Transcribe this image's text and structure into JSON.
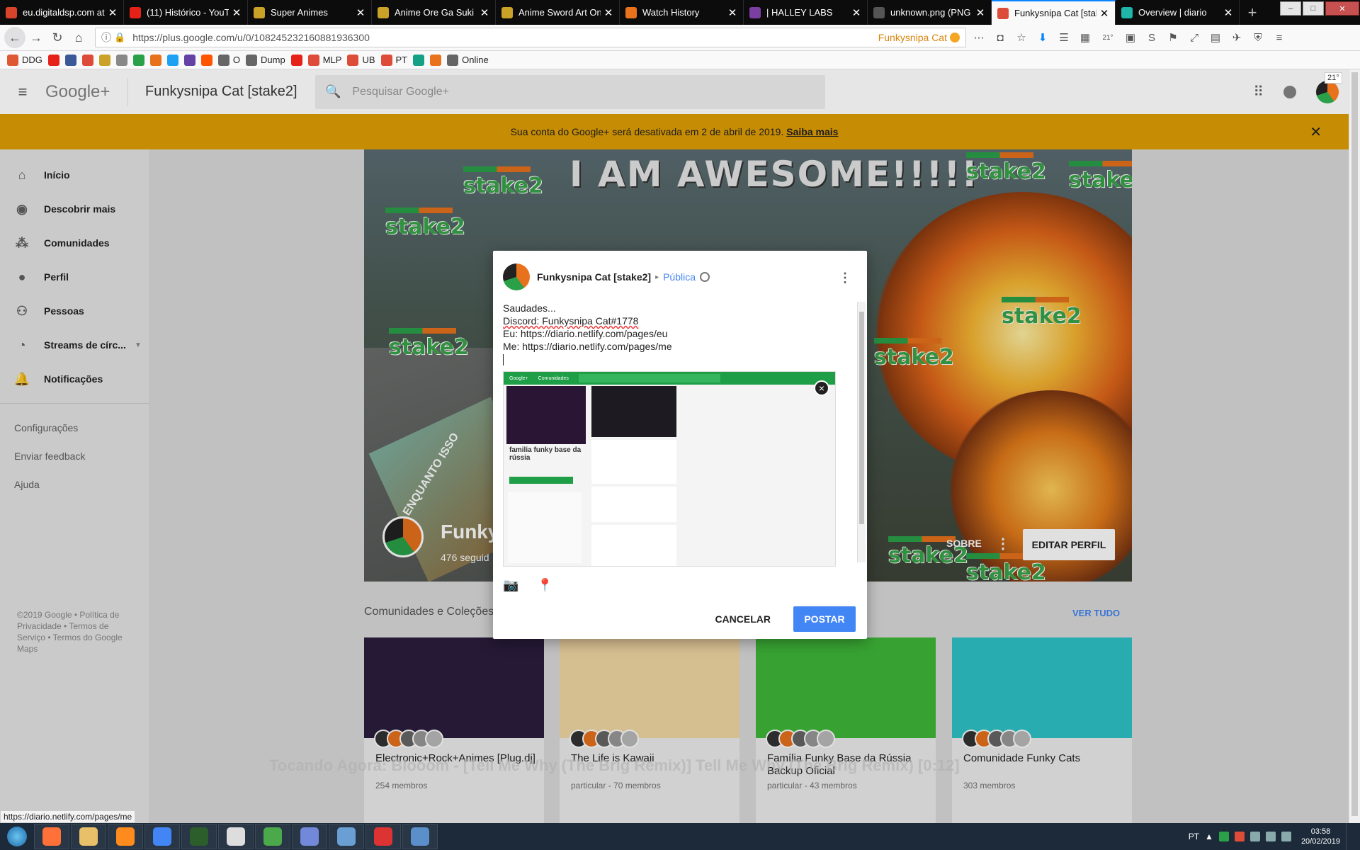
{
  "browser": {
    "tabs": [
      {
        "title": "eu.digitaldsp.com at l",
        "color": "#d8432b",
        "active": false
      },
      {
        "title": "(11) Histórico - YouTu",
        "color": "#e62117",
        "active": false
      },
      {
        "title": "Super Animes",
        "color": "#c9a227",
        "active": false
      },
      {
        "title": "Anime Ore Ga Suki N",
        "color": "#c9a227",
        "active": false
      },
      {
        "title": "Anime Sword Art Onl",
        "color": "#c9a227",
        "active": false
      },
      {
        "title": "Watch History",
        "color": "#e8731c",
        "active": false
      },
      {
        "title": "| HALLEY LABS",
        "color": "#7a3fa0",
        "active": false
      },
      {
        "title": "unknown.png (PNG Imag",
        "color": "#555555",
        "active": false
      },
      {
        "title": "Funkysnipa Cat [stak",
        "color": "#dd4b39",
        "active": true
      },
      {
        "title": "Overview | diario",
        "color": "#1fb5a8",
        "active": false
      }
    ],
    "url": "https://plus.google.com/u/0/108245232160881936300",
    "url_account": "Funkysnipa Cat",
    "badge_count": "21°",
    "bookmarks": [
      {
        "label": "DDG",
        "color": "#de5833"
      },
      {
        "label": "",
        "color": "#e62117"
      },
      {
        "label": "",
        "color": "#3b5998"
      },
      {
        "label": "",
        "color": "#dd4b39"
      },
      {
        "label": "",
        "color": "#c9a227"
      },
      {
        "label": "",
        "color": "#888888"
      },
      {
        "label": "",
        "color": "#2aa149"
      },
      {
        "label": "",
        "color": "#e8711c"
      },
      {
        "label": "",
        "color": "#1da1f2"
      },
      {
        "label": "",
        "color": "#6441a5"
      },
      {
        "label": "",
        "color": "#ff5500"
      },
      {
        "label": "O",
        "color": "#666666"
      },
      {
        "label": "Dump",
        "color": "#666666"
      },
      {
        "label": "",
        "color": "#e62117"
      },
      {
        "label": "MLP",
        "color": "#dd4b39"
      },
      {
        "label": "UB",
        "color": "#dd4b39"
      },
      {
        "label": "PT",
        "color": "#dd4b39"
      },
      {
        "label": "",
        "color": "#16a085"
      },
      {
        "label": "",
        "color": "#e8731c"
      },
      {
        "label": "Online",
        "color": "#666666"
      }
    ]
  },
  "google_plus": {
    "logo": "Google+",
    "profile_title": "Funkysnipa Cat [stake2]",
    "search_placeholder": "Pesquisar Google+",
    "banner_text": "Sua conta do Google+ será desativada em 2 de abril de 2019.",
    "banner_link": "Saiba mais",
    "nav": [
      {
        "label": "Início",
        "icon": "home-icon",
        "glyph": "⌂"
      },
      {
        "label": "Descobrir mais",
        "icon": "compass-icon",
        "glyph": "◉"
      },
      {
        "label": "Comunidades",
        "icon": "communities-icon",
        "glyph": "⁂"
      },
      {
        "label": "Perfil",
        "icon": "profile-icon",
        "glyph": "●"
      },
      {
        "label": "Pessoas",
        "icon": "people-icon",
        "glyph": "⚇"
      },
      {
        "label": "Streams de círc...",
        "icon": "streams-icon",
        "glyph": "◔"
      },
      {
        "label": "Notificações",
        "icon": "bell-icon",
        "glyph": "🔔"
      }
    ],
    "secondary": [
      "Configurações",
      "Enviar feedback",
      "Ajuda"
    ],
    "footer": "©2019 Google • Política de Privacidade • Termos de Serviço • Termos do Google Maps",
    "cover": {
      "headline": "I AM AWESOME!!!!!",
      "sticker": "stake2",
      "sign_text": "ENQUANTO ISSO",
      "name": "Funky",
      "followers": "476 seguid",
      "sobre": "SOBRE",
      "edit_button": "EDITAR PERFIL"
    },
    "section_title": "Comunidades e Coleções",
    "see_all": "VER TUDO",
    "communities": [
      {
        "name": "Electronic+Rock+Animes [Plug.dj]",
        "meta": "254 membros",
        "color": "#2b1d3d"
      },
      {
        "name": "The Life is Kawaii",
        "meta": "particular - 70 membros",
        "color": "#f3d9a4"
      },
      {
        "name": "Família Funky Base da Rússia Backup Oficial",
        "meta": "particular - 43 membros",
        "color": "#3fb93a"
      },
      {
        "name": "Comunidade Funky Cats",
        "meta": "303 membros",
        "color": "#2ec4c8"
      }
    ],
    "now_playing": "Tocando Agora: Blooom - [Tell Me Why (The Brig Remix)] Tell Me Why (The Brig Remix) [0:12]"
  },
  "dialog": {
    "author": "Funkysnipa Cat [stake2]",
    "visibility": "Pública",
    "lines": [
      "Saudades...",
      "Discord: Funkysnipa Cat#1778",
      "Eu: https://diario.netlify.com/pages/eu",
      "Me: https://diario.netlify.com/pages/me"
    ],
    "preview": {
      "bar_brand": "Google+",
      "bar_tab": "Comunidades",
      "title": "familia funky base da rússia",
      "close": "×"
    },
    "cancel": "CANCELAR",
    "post": "POSTAR"
  },
  "status_url": "https://diario.netlify.com/pages/me",
  "taskbar": {
    "apps": [
      "#ff7139",
      "#e8c06a",
      "#ff8a1e",
      "#4285f4",
      "#2b5e2b",
      "#dddddd",
      "#4ba84b",
      "#7289da",
      "#6a9fd4",
      "#d33",
      "#5b8fc9"
    ],
    "lang": "PT",
    "time": "03:58",
    "date": "20/02/2019"
  }
}
